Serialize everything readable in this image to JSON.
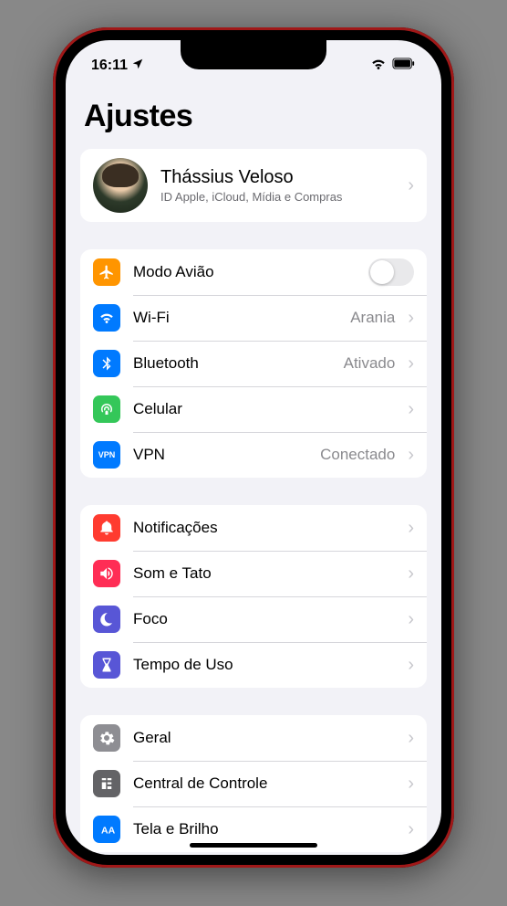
{
  "status": {
    "time": "16:11",
    "location_icon": "location"
  },
  "page": {
    "title": "Ajustes"
  },
  "profile": {
    "name": "Thássius Veloso",
    "subtitle": "ID Apple, iCloud, Mídia e Compras"
  },
  "groups": [
    {
      "items": [
        {
          "id": "airplane",
          "label": "Modo Avião",
          "icon_bg": "bg-orange",
          "control": "toggle",
          "toggle_on": false
        },
        {
          "id": "wifi",
          "label": "Wi-Fi",
          "icon_bg": "bg-blue",
          "control": "value",
          "value": "Arania"
        },
        {
          "id": "bluetooth",
          "label": "Bluetooth",
          "icon_bg": "bg-blue",
          "control": "value",
          "value": "Ativado"
        },
        {
          "id": "cellular",
          "label": "Celular",
          "icon_bg": "bg-green",
          "control": "chevron"
        },
        {
          "id": "vpn",
          "label": "VPN",
          "icon_bg": "bg-blue",
          "control": "value",
          "value": "Conectado",
          "icon_text": "VPN"
        }
      ]
    },
    {
      "items": [
        {
          "id": "notifications",
          "label": "Notificações",
          "icon_bg": "bg-red",
          "control": "chevron"
        },
        {
          "id": "sounds",
          "label": "Som e Tato",
          "icon_bg": "bg-pink",
          "control": "chevron"
        },
        {
          "id": "focus",
          "label": "Foco",
          "icon_bg": "bg-indigo",
          "control": "chevron"
        },
        {
          "id": "screentime",
          "label": "Tempo de Uso",
          "icon_bg": "bg-indigo",
          "control": "chevron"
        }
      ]
    },
    {
      "items": [
        {
          "id": "general",
          "label": "Geral",
          "icon_bg": "bg-gray",
          "control": "chevron"
        },
        {
          "id": "controlcenter",
          "label": "Central de Controle",
          "icon_bg": "bg-darkgray",
          "control": "chevron"
        },
        {
          "id": "display",
          "label": "Tela e Brilho",
          "icon_bg": "bg-blue",
          "control": "chevron"
        }
      ]
    }
  ]
}
